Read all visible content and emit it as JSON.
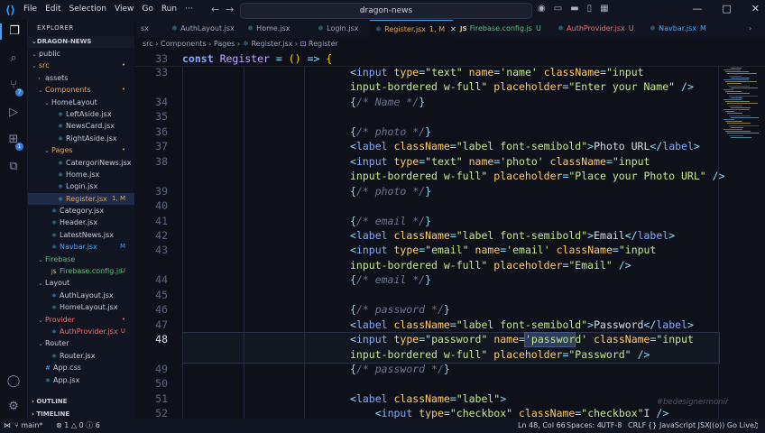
{
  "titlebar": {
    "menu": [
      "File",
      "Edit",
      "Selection",
      "View",
      "Go",
      "Run"
    ],
    "search_text": "dragon-news"
  },
  "activitybar": {
    "icons": [
      "files-icon",
      "search-icon",
      "source-control-icon",
      "run-debug-icon",
      "extensions-icon",
      "remote-explorer-icon"
    ],
    "source_control_badge": "7",
    "extensions_badge": "1"
  },
  "sidebar": {
    "header": "EXPLORER",
    "project": "DRAGON-NEWS",
    "tree": [
      {
        "label": "public",
        "depth": 0,
        "kind": "folder-open",
        "status": "",
        "cls": ""
      },
      {
        "label": "src",
        "depth": 0,
        "kind": "folder-open",
        "status": "•",
        "cls": "folder-mod"
      },
      {
        "label": "assets",
        "depth": 1,
        "kind": "folder",
        "status": "",
        "cls": ""
      },
      {
        "label": "Components",
        "depth": 1,
        "kind": "folder-open",
        "status": "•",
        "cls": "folder-mod"
      },
      {
        "label": "HomeLayout",
        "depth": 2,
        "kind": "folder-open",
        "status": "",
        "cls": ""
      },
      {
        "label": "LeftAside.jsx",
        "depth": 3,
        "kind": "react",
        "status": "",
        "cls": ""
      },
      {
        "label": "NewsCard.jsx",
        "depth": 3,
        "kind": "react",
        "status": "",
        "cls": ""
      },
      {
        "label": "RightAside.jsx",
        "depth": 3,
        "kind": "react",
        "status": "",
        "cls": ""
      },
      {
        "label": "Pages",
        "depth": 2,
        "kind": "folder-open",
        "status": "•",
        "cls": "folder-mod"
      },
      {
        "label": "CatergoriNews.jsx",
        "depth": 3,
        "kind": "react",
        "status": "",
        "cls": ""
      },
      {
        "label": "Home.jsx",
        "depth": 3,
        "kind": "react",
        "status": "",
        "cls": ""
      },
      {
        "label": "Login.jsx",
        "depth": 3,
        "kind": "react",
        "status": "",
        "cls": ""
      },
      {
        "label": "Register.jsx",
        "depth": 3,
        "kind": "react",
        "status": "1, M",
        "cls": "folder-mod",
        "selected": true
      },
      {
        "label": "Category.jsx",
        "depth": 2,
        "kind": "react",
        "status": "",
        "cls": ""
      },
      {
        "label": "Header.jsx",
        "depth": 2,
        "kind": "react",
        "status": "",
        "cls": ""
      },
      {
        "label": "LatestNews.jsx",
        "depth": 2,
        "kind": "react",
        "status": "",
        "cls": ""
      },
      {
        "label": "Navbar.jsx",
        "depth": 2,
        "kind": "react",
        "status": "M",
        "cls": "mod"
      },
      {
        "label": "Firebase",
        "depth": 1,
        "kind": "folder-open",
        "status": "",
        "cls": "folder-unt"
      },
      {
        "label": "Firebase.config.js",
        "depth": 2,
        "kind": "js",
        "status": "U",
        "cls": "unt"
      },
      {
        "label": "Layout",
        "depth": 1,
        "kind": "folder-open",
        "status": "",
        "cls": ""
      },
      {
        "label": "AuthLayout.jsx",
        "depth": 2,
        "kind": "react",
        "status": "",
        "cls": ""
      },
      {
        "label": "HomeLayout.jsx",
        "depth": 2,
        "kind": "react",
        "status": "",
        "cls": ""
      },
      {
        "label": "Provider",
        "depth": 1,
        "kind": "folder-open",
        "status": "•",
        "cls": "err"
      },
      {
        "label": "AuthProvider.jsx",
        "depth": 2,
        "kind": "react",
        "status": "U",
        "cls": "err"
      },
      {
        "label": "Router",
        "depth": 1,
        "kind": "folder-open",
        "status": "",
        "cls": ""
      },
      {
        "label": "Router.jsx",
        "depth": 2,
        "kind": "react",
        "status": "",
        "cls": ""
      },
      {
        "label": "App.css",
        "depth": 1,
        "kind": "css",
        "status": "",
        "cls": ""
      },
      {
        "label": "App.jsx",
        "depth": 1,
        "kind": "react",
        "status": "",
        "cls": ""
      }
    ],
    "outline": "OUTLINE",
    "timeline": "TIMELINE"
  },
  "tabs": [
    {
      "label": "sx",
      "kind": "none",
      "status": "",
      "cls": ""
    },
    {
      "label": "AuthLayout.jsx",
      "kind": "react",
      "status": "",
      "cls": ""
    },
    {
      "label": "Home.jsx",
      "kind": "react",
      "status": "",
      "cls": ""
    },
    {
      "label": "Login.jsx",
      "kind": "react",
      "status": "",
      "cls": ""
    },
    {
      "label": "Register.jsx",
      "kind": "react",
      "status": "1, M",
      "cls": "folder-mod",
      "active": true
    },
    {
      "label": "Firebase.config.js",
      "kind": "js",
      "status": "U",
      "cls": "unt"
    },
    {
      "label": "AuthProvider.jsx",
      "kind": "react",
      "status": "U",
      "cls": "err"
    },
    {
      "label": "Navbar.jsx",
      "kind": "react",
      "status": "M",
      "cls": "mod"
    }
  ],
  "breadcrumb": [
    "src",
    "Components",
    "Pages",
    "Register.jsx",
    "Register"
  ],
  "editor": {
    "current_line": "48",
    "lines": [
      {
        "n": "33",
        "indent": 0,
        "code": ""
      },
      {
        "n": "34",
        "indent": 0,
        "code": ""
      },
      {
        "n": "35",
        "indent": 0,
        "code": ""
      },
      {
        "n": "36",
        "indent": 0,
        "code": ""
      },
      {
        "n": "37",
        "indent": 0,
        "code": ""
      },
      {
        "n": "38",
        "indent": 0,
        "code": ""
      },
      {
        "n": "39",
        "indent": 0,
        "code": ""
      },
      {
        "n": "40",
        "indent": 0,
        "code": ""
      },
      {
        "n": "41",
        "indent": 0,
        "code": ""
      },
      {
        "n": "42",
        "indent": 0,
        "code": ""
      },
      {
        "n": "43",
        "indent": 0,
        "code": ""
      },
      {
        "n": "44",
        "indent": 0,
        "code": ""
      },
      {
        "n": "45",
        "indent": 0,
        "code": ""
      },
      {
        "n": "46",
        "indent": 0,
        "code": ""
      },
      {
        "n": "47",
        "indent": 0,
        "code": ""
      },
      {
        "n": "48",
        "indent": 0,
        "code": ""
      },
      {
        "n": "49",
        "indent": 0,
        "code": ""
      },
      {
        "n": "50",
        "indent": 0,
        "code": ""
      },
      {
        "n": "51",
        "indent": 0,
        "code": ""
      },
      {
        "n": "52",
        "indent": 0,
        "code": ""
      }
    ],
    "sticky_tokens": [
      [
        "kwb",
        "const"
      ],
      [
        "",
        " "
      ],
      [
        "fn",
        "Register"
      ],
      [
        "",
        " "
      ],
      [
        "pu",
        "="
      ],
      [
        "",
        " "
      ],
      [
        "br",
        "()"
      ],
      [
        "",
        " "
      ],
      [
        "pu",
        "=>"
      ],
      [
        "",
        " "
      ],
      [
        "br",
        "{"
      ]
    ],
    "rows": [
      [
        [
          "pu",
          "<"
        ],
        [
          "tg",
          "input"
        ],
        [
          "",
          " "
        ],
        [
          "at",
          "type"
        ],
        [
          "pu",
          "="
        ],
        [
          "sv",
          "\"text\""
        ],
        [
          "",
          " "
        ],
        [
          "at",
          "name"
        ],
        [
          "pu",
          "="
        ],
        [
          "sv",
          "'name'"
        ],
        [
          "",
          " "
        ],
        [
          "at",
          "className"
        ],
        [
          "pu",
          "="
        ],
        [
          "sv",
          "\"input"
        ]
      ],
      [
        [
          "sv",
          "input-bordered w-full\""
        ],
        [
          "",
          " "
        ],
        [
          "at",
          "placeholder"
        ],
        [
          "pu",
          "="
        ],
        [
          "sv",
          "\"Enter your Name\""
        ],
        [
          "",
          " "
        ],
        [
          "pu",
          "/>"
        ]
      ],
      [
        [
          "pu",
          "{"
        ],
        [
          "cm",
          "/* Name */"
        ],
        [
          "pu",
          "}"
        ]
      ],
      [],
      [
        [
          "pu",
          "{"
        ],
        [
          "cm",
          "/* photo */"
        ],
        [
          "pu",
          "}"
        ]
      ],
      [
        [
          "pu",
          "<"
        ],
        [
          "tg",
          "label"
        ],
        [
          "",
          " "
        ],
        [
          "at",
          "className"
        ],
        [
          "pu",
          "="
        ],
        [
          "sv",
          "\"label font-semibold\""
        ],
        [
          "pu",
          ">"
        ],
        [
          "",
          "Photo URL"
        ],
        [
          "pu",
          "</"
        ],
        [
          "tg",
          "label"
        ],
        [
          "pu",
          ">"
        ]
      ],
      [
        [
          "pu",
          "<"
        ],
        [
          "tg",
          "input"
        ],
        [
          "",
          " "
        ],
        [
          "at",
          "type"
        ],
        [
          "pu",
          "="
        ],
        [
          "sv",
          "\"text\""
        ],
        [
          "",
          " "
        ],
        [
          "at",
          "name"
        ],
        [
          "pu",
          "="
        ],
        [
          "sv",
          "'photo'"
        ],
        [
          "",
          " "
        ],
        [
          "at",
          "className"
        ],
        [
          "pu",
          "="
        ],
        [
          "sv",
          "\"input"
        ]
      ],
      [
        [
          "sv",
          "input-bordered w-full\""
        ],
        [
          "",
          " "
        ],
        [
          "at",
          "placeholder"
        ],
        [
          "pu",
          "="
        ],
        [
          "sv",
          "\"Place your Photo URL\""
        ],
        [
          "",
          " "
        ],
        [
          "pu",
          "/>"
        ]
      ],
      [
        [
          "pu",
          "{"
        ],
        [
          "cm",
          "/* photo */"
        ],
        [
          "pu",
          "}"
        ]
      ],
      [],
      [
        [
          "pu",
          "{"
        ],
        [
          "cm",
          "/* email */"
        ],
        [
          "pu",
          "}"
        ]
      ],
      [
        [
          "pu",
          "<"
        ],
        [
          "tg",
          "label"
        ],
        [
          "",
          " "
        ],
        [
          "at",
          "className"
        ],
        [
          "pu",
          "="
        ],
        [
          "sv",
          "\"label font-semibold\""
        ],
        [
          "pu",
          ">"
        ],
        [
          "",
          "Email"
        ],
        [
          "pu",
          "</"
        ],
        [
          "tg",
          "label"
        ],
        [
          "pu",
          ">"
        ]
      ],
      [
        [
          "pu",
          "<"
        ],
        [
          "tg",
          "input"
        ],
        [
          "",
          " "
        ],
        [
          "at",
          "type"
        ],
        [
          "pu",
          "="
        ],
        [
          "sv",
          "\"email\""
        ],
        [
          "",
          " "
        ],
        [
          "at",
          "name"
        ],
        [
          "pu",
          "="
        ],
        [
          "sv",
          "'email'"
        ],
        [
          "",
          " "
        ],
        [
          "at",
          "className"
        ],
        [
          "pu",
          "="
        ],
        [
          "sv",
          "\"input"
        ]
      ],
      [
        [
          "sv",
          "input-bordered w-full\""
        ],
        [
          "",
          " "
        ],
        [
          "at",
          "placeholder"
        ],
        [
          "pu",
          "="
        ],
        [
          "sv",
          "\"Email\""
        ],
        [
          "",
          " "
        ],
        [
          "pu",
          "/>"
        ]
      ],
      [
        [
          "pu",
          "{"
        ],
        [
          "cm",
          "/* email */"
        ],
        [
          "pu",
          "}"
        ]
      ],
      [],
      [
        [
          "pu",
          "{"
        ],
        [
          "cm",
          "/* password */"
        ],
        [
          "pu",
          "}"
        ]
      ],
      [
        [
          "pu",
          "<"
        ],
        [
          "tg",
          "label"
        ],
        [
          "",
          " "
        ],
        [
          "at",
          "className"
        ],
        [
          "pu",
          "="
        ],
        [
          "sv",
          "\"label font-semibold\""
        ],
        [
          "pu",
          ">"
        ],
        [
          "",
          "Password"
        ],
        [
          "pu",
          "</"
        ],
        [
          "tg",
          "label"
        ],
        [
          "pu",
          ">"
        ]
      ],
      [
        [
          "pu",
          "<"
        ],
        [
          "tg",
          "input"
        ],
        [
          "",
          " "
        ],
        [
          "at",
          "type"
        ],
        [
          "pu",
          "="
        ],
        [
          "sv",
          "\"password\""
        ],
        [
          "",
          " "
        ],
        [
          "at",
          "name"
        ],
        [
          "pu",
          "="
        ],
        [
          "sv",
          "'password'"
        ],
        [
          "",
          " "
        ],
        [
          "at",
          "className"
        ],
        [
          "pu",
          "="
        ],
        [
          "sv",
          "\"input"
        ]
      ],
      [
        [
          "sv",
          "input-bordered w-full\""
        ],
        [
          "",
          " "
        ],
        [
          "at",
          "placeholder"
        ],
        [
          "pu",
          "="
        ],
        [
          "sv",
          "\"Password\""
        ],
        [
          "",
          " "
        ],
        [
          "pu",
          "/>"
        ]
      ],
      [
        [
          "pu",
          "{"
        ],
        [
          "cm",
          "/* password */"
        ],
        [
          "pu",
          "}"
        ]
      ],
      [],
      [
        [
          "pu",
          "<"
        ],
        [
          "tg",
          "label"
        ],
        [
          "",
          " "
        ],
        [
          "at",
          "className"
        ],
        [
          "pu",
          "="
        ],
        [
          "sv",
          "\"label\""
        ],
        [
          "pu",
          ">"
        ]
      ],
      [
        [
          "",
          "    "
        ],
        [
          "pu",
          "<"
        ],
        [
          "tg",
          "input"
        ],
        [
          "",
          " "
        ],
        [
          "at",
          "type"
        ],
        [
          "pu",
          "="
        ],
        [
          "sv",
          "\"checkbox\""
        ],
        [
          "",
          " "
        ],
        [
          "at",
          "className"
        ],
        [
          "pu",
          "="
        ],
        [
          "sv",
          "\"checkbox\""
        ],
        [
          "",
          "I"
        ],
        [
          "pu",
          " />"
        ]
      ]
    ],
    "row_line_numbers": [
      "33",
      "",
      "34",
      "35",
      "36",
      "37",
      "38",
      "",
      "39",
      "40",
      "41",
      "42",
      "43",
      "",
      "44",
      "45",
      "46",
      "47",
      "48",
      "",
      "49",
      "50",
      "51",
      "52"
    ]
  },
  "status": {
    "branch": "main*",
    "errors": "1",
    "warnings": "0",
    "info": "6",
    "position": "Ln 48, Col 66",
    "spaces": "Spaces: 4",
    "encoding": "UTF-8",
    "eol": "CRLF",
    "language": "JavaScript JSX",
    "golive": "Go Live"
  },
  "watermark": "#bedesignermonir"
}
